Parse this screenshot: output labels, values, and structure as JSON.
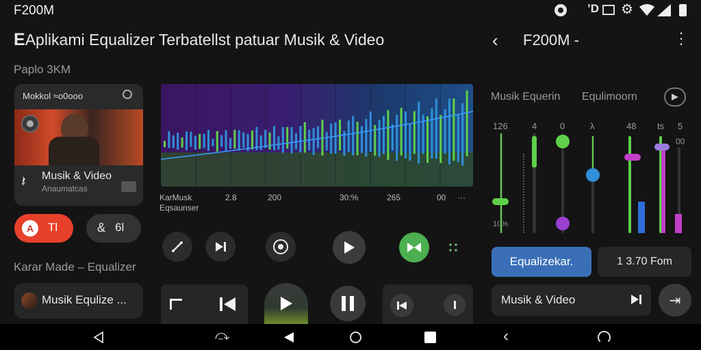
{
  "status_bar": {
    "time": "F200M",
    "icons": [
      "record-icon",
      "signal-status-icon",
      "image-icon",
      "gear-icon",
      "wifi-icon",
      "cellular-icon",
      "battery-icon"
    ]
  },
  "header": {
    "title_initial": "E",
    "title": "Aplikami Equalizer Terbatellst patuar Musik & Video",
    "right_title": "F200M -"
  },
  "left": {
    "section_label": "Paplo 3KM",
    "card": {
      "header": "Mokkol ≈o0ooo",
      "title": "Musik & Video",
      "subtitle": "Anaumatcas"
    },
    "btn_primary": "Tl",
    "btn_primary_icon_text": "A",
    "btn_secondary": "6l",
    "btn_secondary_icon_text": "&",
    "section_label2": "Karar Made – Equalizer",
    "list_item": "Musik Equlize ..."
  },
  "visualizer": {
    "overlay_label_1": "KarMusk",
    "overlay_label_2": "Eqsaunser",
    "ticks": [
      "2.8",
      "200",
      "30:%",
      "265",
      "00"
    ],
    "accent_colors": [
      "#7a2fd0",
      "#2f8fd8",
      "#5fd04a"
    ]
  },
  "right": {
    "tab1": "Musik Equerin",
    "tab2": "Equlimoorn",
    "slider_top_labels": [
      "126",
      "4",
      "0",
      "λ",
      "48",
      "ts",
      "5"
    ],
    "slider_extra_label": "00",
    "slider_side_label": "10%",
    "slider_levels": [
      0.34,
      0.88,
      0.94,
      0.6,
      0.78,
      0.93,
      0.9
    ],
    "equalizer_btn": "Equalizekar.",
    "freq_value": "1 3.70 Fom",
    "list_item": "Musik & Video"
  },
  "nav_bar": [
    "back-icon",
    "squiggle-icon",
    "play-icon",
    "home-icon",
    "recents-icon",
    "chevron-left-icon",
    "refresh-icon"
  ]
}
